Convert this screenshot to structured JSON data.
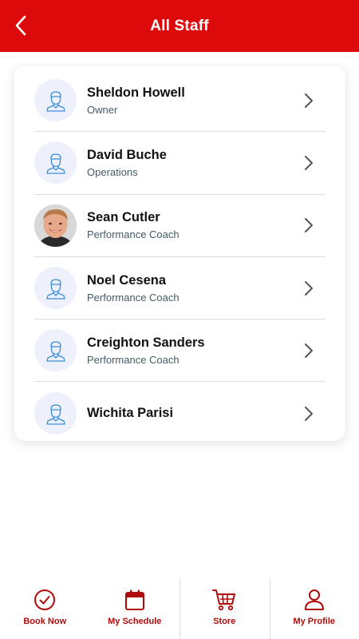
{
  "header": {
    "title": "All Staff"
  },
  "colors": {
    "brand": "#dc0a0a",
    "tab_label": "#b00b0b",
    "avatar_bg": "#eef1fb",
    "avatar_icon": "#3a8fd6"
  },
  "staff": [
    {
      "name": "Sheldon Howell",
      "role": "Owner",
      "avatar": "person-placeholder-icon"
    },
    {
      "name": "David Buche",
      "role": "Operations",
      "avatar": "person-placeholder-icon"
    },
    {
      "name": "Sean Cutler",
      "role": "Performance Coach",
      "avatar": "photo"
    },
    {
      "name": "Noel Cesena",
      "role": "Performance Coach",
      "avatar": "person-placeholder-icon"
    },
    {
      "name": "Creighton Sanders",
      "role": "Performance Coach",
      "avatar": "person-placeholder-icon"
    },
    {
      "name": "Wichita Parisi",
      "role": "",
      "avatar": "person-placeholder-icon"
    }
  ],
  "tabs": [
    {
      "label": "Book Now",
      "icon": "check-circle-icon"
    },
    {
      "label": "My Schedule",
      "icon": "calendar-icon"
    },
    {
      "label": "Store",
      "icon": "cart-icon"
    },
    {
      "label": "My Profile",
      "icon": "user-icon"
    }
  ]
}
